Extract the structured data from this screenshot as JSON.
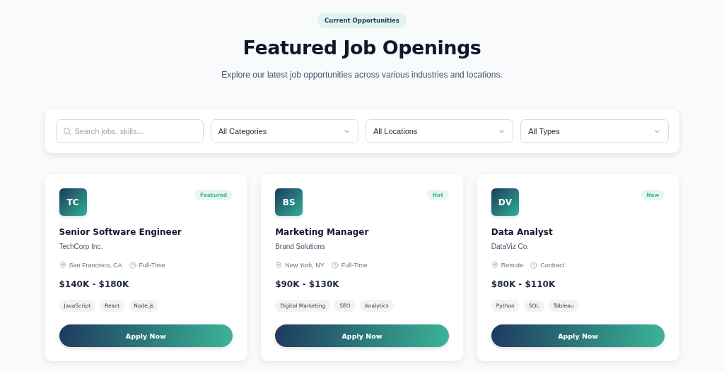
{
  "header": {
    "badge": "Current Opportunities",
    "title": "Featured Job Openings",
    "subtitle": "Explore our latest job opportunities across various industries and locations."
  },
  "filters": {
    "search": {
      "placeholder": "Search jobs, skills..."
    },
    "dropdowns": [
      {
        "value": "All Categories"
      },
      {
        "value": "All Locations"
      },
      {
        "value": "All Types"
      }
    ]
  },
  "jobs": [
    {
      "initials": "TC",
      "tag": "Featured",
      "title": "Senior Software Engineer",
      "company": "TechCorp Inc.",
      "location": "San Francisco, CA",
      "type": "Full-Time",
      "salary": "$140K - $180K",
      "skills": [
        "JavaScript",
        "React",
        "Node.js"
      ],
      "button": "Apply Now"
    },
    {
      "initials": "BS",
      "tag": "Hot",
      "title": "Marketing Manager",
      "company": "Brand Solutions",
      "location": "New York, NY",
      "type": "Full-Time",
      "salary": "$90K - $130K",
      "skills": [
        "Digital Marketing",
        "SEO",
        "Analytics"
      ],
      "button": "Apply Now"
    },
    {
      "initials": "DV",
      "tag": "New",
      "title": "Data Analyst",
      "company": "DataViz Co.",
      "location": "Remote",
      "type": "Contract",
      "salary": "$80K - $110K",
      "skills": [
        "Python",
        "SQL",
        "Tableau"
      ],
      "button": "Apply Now"
    }
  ]
}
